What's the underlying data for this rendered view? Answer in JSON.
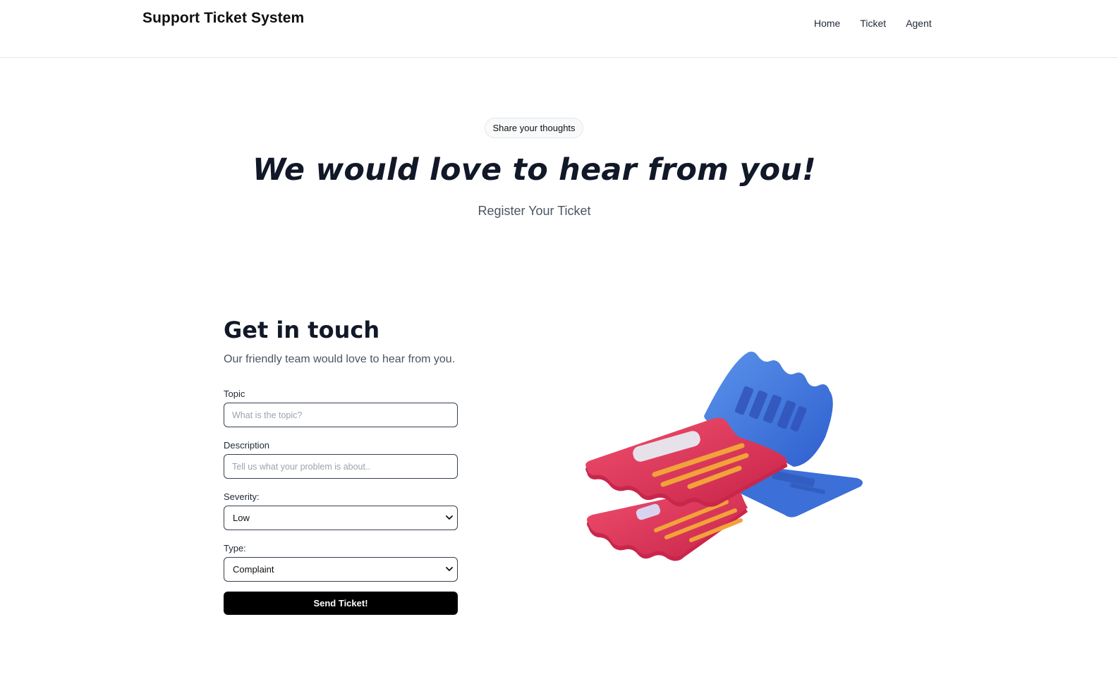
{
  "header": {
    "brand": "Support Ticket System",
    "nav": [
      {
        "label": "Home"
      },
      {
        "label": "Ticket"
      },
      {
        "label": "Agent"
      }
    ]
  },
  "hero": {
    "badge": "Share your thoughts",
    "title": "We would love to hear from you!",
    "subtitle": "Register Your Ticket"
  },
  "contact": {
    "title": "Get in touch",
    "description": "Our friendly team would love to hear from you.",
    "topic": {
      "label": "Topic",
      "placeholder": "What is the topic?",
      "value": ""
    },
    "description_field": {
      "label": "Description",
      "placeholder": "Tell us what your problem is about..",
      "value": ""
    },
    "severity": {
      "label": "Severity:",
      "selected": "Low"
    },
    "type": {
      "label": "Type:",
      "selected": "Complaint"
    },
    "submit_label": "Send Ticket!"
  },
  "colors": {
    "accent": "#000000",
    "ticket_red": "#e23a5a",
    "ticket_blue": "#4a7fe0",
    "ticket_stripe": "#f2a23a"
  },
  "icons": {
    "select_chevron": "chevron-down-icon",
    "illustration": "tickets-illustration"
  }
}
